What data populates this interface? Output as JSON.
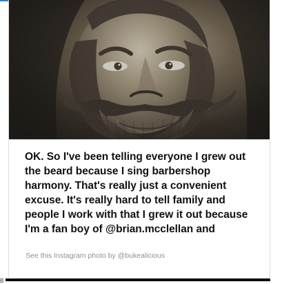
{
  "embed": {
    "caption": "OK. So I've been telling everyone I grew out the beard because I sing barbershop harmony. That's really just a convenient excuse. It's really hard to tell family and people I work with that I grew it out because I'm a fan boy of @brian.mcclellan and",
    "attribution": "See this Instagram photo by @bukealicious"
  },
  "page_fragment": {
    "left_text": "B"
  },
  "colors": {
    "top_accent": "#3b79c4",
    "caption_text": "#111111",
    "attribution_text": "#8f8f8f",
    "bottom_bar": "#050505"
  }
}
